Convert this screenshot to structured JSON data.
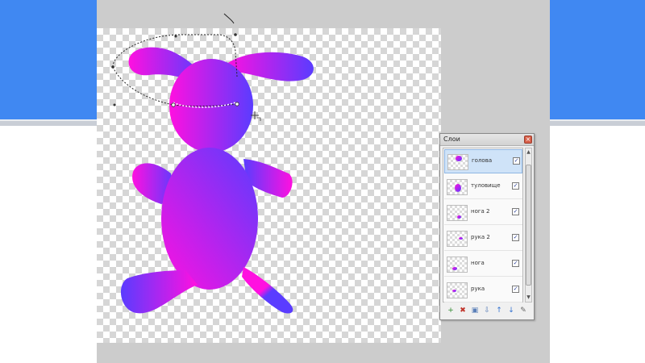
{
  "layers_panel": {
    "title": "Слои",
    "close_label": "×",
    "layers": [
      {
        "name": "голова",
        "visible_mark": "✓",
        "selected": true
      },
      {
        "name": "туловище",
        "visible_mark": "✓",
        "selected": false
      },
      {
        "name": "нога 2",
        "visible_mark": "✓",
        "selected": false
      },
      {
        "name": "рука 2",
        "visible_mark": "✓",
        "selected": false
      },
      {
        "name": "нога",
        "visible_mark": "✓",
        "selected": false
      },
      {
        "name": "рука",
        "visible_mark": "✓",
        "selected": false
      }
    ],
    "scroll_up": "▲",
    "scroll_down": "▼",
    "toolbar": {
      "add": "+",
      "delete": "✖",
      "duplicate": "▣",
      "merge": "⇩",
      "move_up": "↑",
      "move_down": "↓",
      "properties": "✎"
    }
  },
  "colors": {
    "slide_blue": "#4088f2",
    "workspace_gray": "#cccccc",
    "gradient_magenta": "#ff10e0",
    "gradient_blue": "#5a3cff"
  },
  "icons": {
    "close": "close-icon",
    "checkbox": "checkbox-icon",
    "add_layer": "add-layer-icon",
    "delete_layer": "delete-layer-icon",
    "duplicate_layer": "duplicate-layer-icon",
    "merge_layer": "merge-layer-icon",
    "move_up": "arrow-up-icon",
    "move_down": "arrow-down-icon",
    "properties": "properties-icon",
    "move_cursor": "move-cursor-icon"
  }
}
